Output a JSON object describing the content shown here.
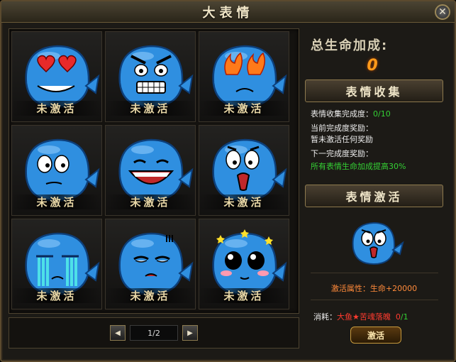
{
  "window": {
    "title": "大表情",
    "close_glyph": "✕"
  },
  "grid": {
    "page": "1/2",
    "items": [
      {
        "label": "未激活",
        "face": "heart-eyes"
      },
      {
        "label": "未激活",
        "face": "angry"
      },
      {
        "label": "未激活",
        "face": "fire-eyes"
      },
      {
        "label": "未激活",
        "face": "goofy"
      },
      {
        "label": "未激活",
        "face": "laugh"
      },
      {
        "label": "未激活",
        "face": "shocked"
      },
      {
        "label": "未激活",
        "face": "cry"
      },
      {
        "label": "未激活",
        "face": "bored"
      },
      {
        "label": "未激活",
        "face": "dizzy"
      }
    ]
  },
  "panel": {
    "bonus_label": "总生命加成:",
    "bonus_value": "0",
    "collection_header": "表情收集",
    "progress_label": "表情收集完成度：",
    "progress_value": "0/10",
    "current_reward_label": "当前完成度奖励：",
    "current_reward_value": "暂未激活任何奖励",
    "next_reward_label": "下一完成度奖励：",
    "next_reward_value": "所有表情生命加成提高30%",
    "activate_header": "表情激活",
    "attr_text": "激活属性：生命+20000",
    "cost_label": "消耗：",
    "cost_item": "大鱼★苦魂落魄",
    "cost_count": "0",
    "cost_total": "/1",
    "activate_button": "激活"
  },
  "colors": {
    "whale_body": "#2f8fe0",
    "whale_dark": "#1a5fb0",
    "accent_orange": "#ff9a1a",
    "green": "#34d034"
  }
}
